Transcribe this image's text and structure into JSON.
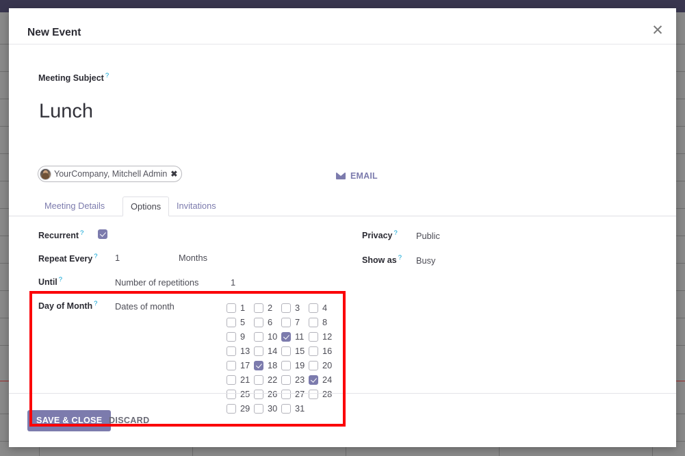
{
  "window": {
    "topbar_color": "#39364f",
    "accent_color": "#7c7bad",
    "highlight_color": "#fb0007"
  },
  "dialog": {
    "title": "New Event",
    "close_icon": "close-icon"
  },
  "subject": {
    "label": "Meeting Subject",
    "helper": "?",
    "value": "Lunch"
  },
  "attendee": {
    "name": "YourCompany, Mitchell Admin",
    "remove_icon": "✖",
    "avatar_icon": "avatar"
  },
  "email_button": {
    "label": "EMAIL",
    "icon": "envelope-icon"
  },
  "tabs": [
    {
      "label": "Meeting Details",
      "active": false
    },
    {
      "label": "Options",
      "active": true
    },
    {
      "label": "Invitations",
      "active": false
    }
  ],
  "options": {
    "recurrent": {
      "label": "Recurrent",
      "helper": "?",
      "checked": true
    },
    "repeat_every": {
      "label": "Repeat Every",
      "helper": "?",
      "count": "1",
      "unit": "Months"
    },
    "until": {
      "label": "Until",
      "helper": "?",
      "mode": "Number of repetitions",
      "number": "1"
    },
    "day_of_month": {
      "label": "Day of Month",
      "helper": "?",
      "mode": "Dates of month",
      "days": [
        {
          "n": "1",
          "checked": false
        },
        {
          "n": "2",
          "checked": false
        },
        {
          "n": "3",
          "checked": false
        },
        {
          "n": "4",
          "checked": false
        },
        {
          "n": "5",
          "checked": false
        },
        {
          "n": "6",
          "checked": false
        },
        {
          "n": "7",
          "checked": false
        },
        {
          "n": "8",
          "checked": false
        },
        {
          "n": "9",
          "checked": false
        },
        {
          "n": "10",
          "checked": false
        },
        {
          "n": "11",
          "checked": true
        },
        {
          "n": "12",
          "checked": false
        },
        {
          "n": "13",
          "checked": false
        },
        {
          "n": "14",
          "checked": false
        },
        {
          "n": "15",
          "checked": false
        },
        {
          "n": "16",
          "checked": false
        },
        {
          "n": "17",
          "checked": false
        },
        {
          "n": "18",
          "checked": true
        },
        {
          "n": "19",
          "checked": false
        },
        {
          "n": "20",
          "checked": false
        },
        {
          "n": "21",
          "checked": false
        },
        {
          "n": "22",
          "checked": false
        },
        {
          "n": "23",
          "checked": false
        },
        {
          "n": "24",
          "checked": true
        },
        {
          "n": "25",
          "checked": false
        },
        {
          "n": "26",
          "checked": false
        },
        {
          "n": "27",
          "checked": false
        },
        {
          "n": "28",
          "checked": false
        },
        {
          "n": "29",
          "checked": false
        },
        {
          "n": "30",
          "checked": false
        },
        {
          "n": "31",
          "checked": false
        }
      ]
    },
    "privacy": {
      "label": "Privacy",
      "helper": "?",
      "value": "Public"
    },
    "show_as": {
      "label": "Show as",
      "helper": "?",
      "value": "Busy"
    }
  },
  "footer": {
    "save_label": "SAVE & CLOSE",
    "discard_label": "DISCARD"
  }
}
